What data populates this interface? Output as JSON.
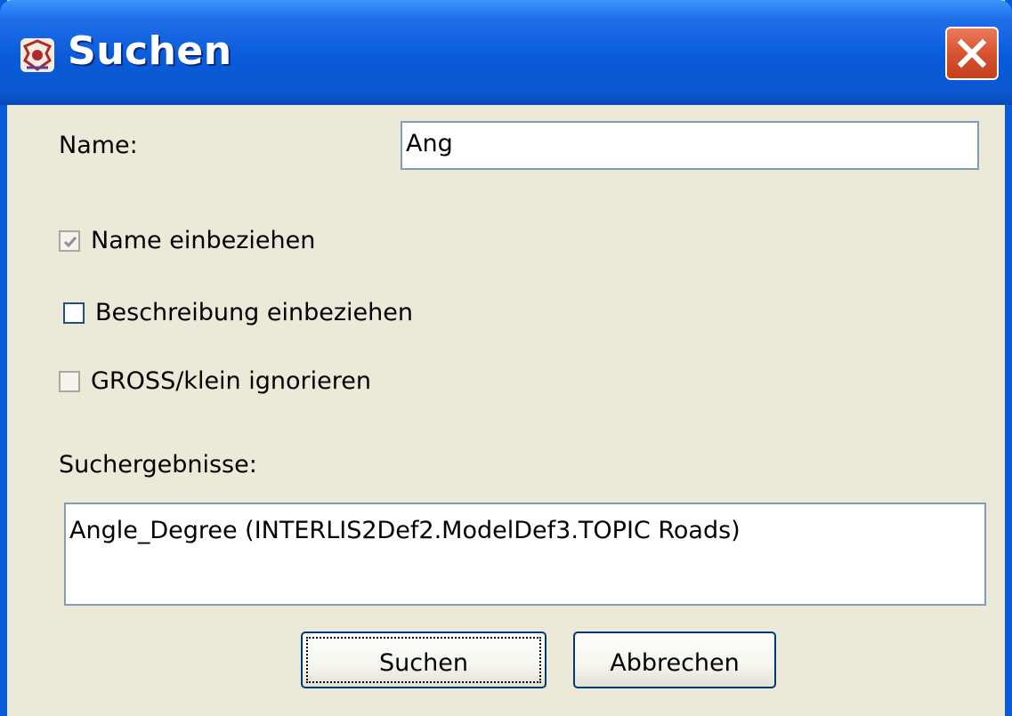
{
  "window": {
    "title": "Suchen"
  },
  "form": {
    "name_label": "Name:",
    "name_value": "Ang",
    "options": [
      {
        "label": "Name einbeziehen",
        "checked": true,
        "enabled": false
      },
      {
        "label": "Beschreibung einbeziehen",
        "checked": false,
        "enabled": true
      },
      {
        "label": "GROSS/klein  ignorieren",
        "checked": false,
        "enabled": false
      }
    ],
    "results_label": "Suchergebnisse:",
    "results": [
      "Angle_Degree (INTERLIS2Def2.ModelDef3.TOPIC Roads)"
    ]
  },
  "buttons": {
    "search": "Suchen",
    "cancel": "Abbrechen"
  },
  "colors": {
    "titlebar": "#0A5BD9",
    "close": "#D8542F",
    "dialog_bg": "#ECE9D8",
    "field_border": "#7F9DB9"
  },
  "icons": {
    "app": "app-logo-icon",
    "close": "close-icon",
    "check": "checkmark-icon"
  }
}
